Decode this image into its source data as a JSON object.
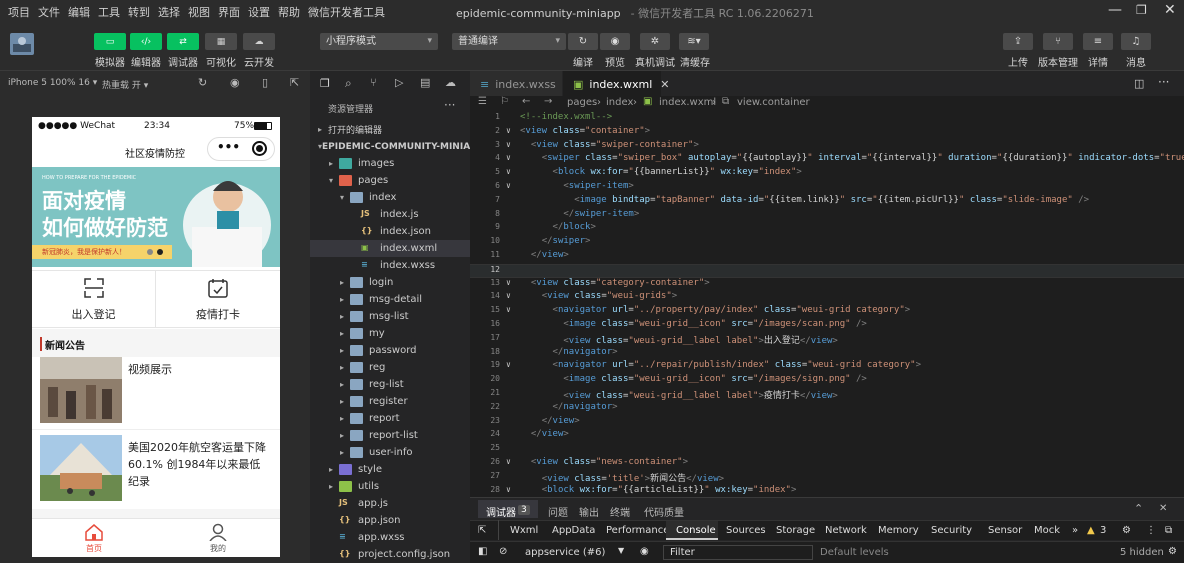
{
  "titlebar": {
    "menu": [
      "项目",
      "文件",
      "编辑",
      "工具",
      "转到",
      "选择",
      "视图",
      "界面",
      "设置",
      "帮助",
      "微信开发者工具"
    ],
    "title": "epidemic-community-miniapp",
    "subtitle": "- 微信开发者工具 RC 1.06.2206271"
  },
  "toolbar": {
    "left_buttons": [
      "模拟器",
      "编辑器",
      "调试器",
      "可视化",
      "云开发"
    ],
    "mode_select": "小程序模式",
    "compile_select": "普通编译",
    "mid_labels": [
      "编译",
      "预览",
      "真机调试",
      "清缓存"
    ],
    "right_labels": [
      "上传",
      "版本管理",
      "详情",
      "消息"
    ]
  },
  "simulator": {
    "device": "iPhone 5 100% 16 ▾",
    "hot_reload": "热重载 开 ▾",
    "status": {
      "carrier": "●●●●● WeChat",
      "time": "23:34",
      "battery": "75%"
    },
    "nav_title": "社区疫情防控",
    "banner": {
      "top": "HOW TO PREPARE FOR THE EPIDEMIC",
      "line1": "面对疫情",
      "line2": "如何做好防范",
      "foot": "新冠肺炎，我是保护新人！"
    },
    "categories": [
      "出入登记",
      "疫情打卡"
    ],
    "news_title": "新闻公告",
    "news": [
      {
        "title": "视频展示"
      },
      {
        "title": "美国2020年航空客运量下降60.1% 创1984年以来最低纪录"
      }
    ],
    "tabs": [
      "首页",
      "我的"
    ]
  },
  "explorer": {
    "header": "资源管理器",
    "open_editors": "打开的编辑器",
    "project": "EPIDEMIC-COMMUNITY-MINIAPP",
    "items": [
      {
        "name": "images",
        "depth": 1,
        "type": "folder-img",
        "arrow": "▸"
      },
      {
        "name": "pages",
        "depth": 1,
        "type": "folder-red",
        "arrow": "▾"
      },
      {
        "name": "index",
        "depth": 2,
        "type": "folder",
        "arrow": "▾"
      },
      {
        "name": "index.js",
        "depth": 3,
        "type": "js",
        "arrow": ""
      },
      {
        "name": "index.json",
        "depth": 3,
        "type": "json",
        "arrow": ""
      },
      {
        "name": "index.wxml",
        "depth": 3,
        "type": "wxml",
        "arrow": "",
        "selected": true
      },
      {
        "name": "index.wxss",
        "depth": 3,
        "type": "wxss",
        "arrow": ""
      },
      {
        "name": "login",
        "depth": 2,
        "type": "folder",
        "arrow": "▸"
      },
      {
        "name": "msg-detail",
        "depth": 2,
        "type": "folder",
        "arrow": "▸"
      },
      {
        "name": "msg-list",
        "depth": 2,
        "type": "folder",
        "arrow": "▸"
      },
      {
        "name": "my",
        "depth": 2,
        "type": "folder",
        "arrow": "▸"
      },
      {
        "name": "password",
        "depth": 2,
        "type": "folder",
        "arrow": "▸"
      },
      {
        "name": "reg",
        "depth": 2,
        "type": "folder",
        "arrow": "▸"
      },
      {
        "name": "reg-list",
        "depth": 2,
        "type": "folder",
        "arrow": "▸"
      },
      {
        "name": "register",
        "depth": 2,
        "type": "folder",
        "arrow": "▸"
      },
      {
        "name": "report",
        "depth": 2,
        "type": "folder",
        "arrow": "▸"
      },
      {
        "name": "report-list",
        "depth": 2,
        "type": "folder",
        "arrow": "▸"
      },
      {
        "name": "user-info",
        "depth": 2,
        "type": "folder",
        "arrow": "▸"
      },
      {
        "name": "style",
        "depth": 1,
        "type": "folder-purple",
        "arrow": "▸"
      },
      {
        "name": "utils",
        "depth": 1,
        "type": "folder-green",
        "arrow": "▸"
      },
      {
        "name": "app.js",
        "depth": 1,
        "type": "js",
        "arrow": ""
      },
      {
        "name": "app.json",
        "depth": 1,
        "type": "json",
        "arrow": ""
      },
      {
        "name": "app.wxss",
        "depth": 1,
        "type": "wxss",
        "arrow": ""
      },
      {
        "name": "project.config.json",
        "depth": 1,
        "type": "json",
        "arrow": ""
      }
    ]
  },
  "editor": {
    "tabs": [
      "index.wxss",
      "index.wxml"
    ],
    "active_tab": "index.wxml",
    "breadcrumb": [
      "pages",
      "index",
      "index.wxml",
      "view.container"
    ],
    "lines": [
      {
        "n": "1",
        "f": "",
        "h": "<span class='c'>&lt;!--index.wxml--&gt;</span>"
      },
      {
        "n": "2",
        "f": "∨",
        "h": "<span class='p'>&lt;</span><span class='t'>view</span> <span class='a'>class</span><span class='d'>=</span><span class='s'>\"container\"</span><span class='p'>&gt;</span>"
      },
      {
        "n": "3",
        "f": "∨",
        "h": "  <span class='p'>&lt;</span><span class='t'>view</span> <span class='a'>class</span><span class='d'>=</span><span class='s'>\"swiper-container\"</span><span class='p'>&gt;</span>"
      },
      {
        "n": "4",
        "f": "∨",
        "h": "    <span class='p'>&lt;</span><span class='t'>swiper</span> <span class='a'>class</span><span class='d'>=</span><span class='s'>\"swiper_box\"</span> <span class='a'>autoplay</span><span class='d'>=</span><span class='s'>\"</span><span class='d'>{{autoplay}}</span><span class='s'>\"</span> <span class='a'>interval</span><span class='d'>=</span><span class='s'>\"</span><span class='d'>{{interval}}</span><span class='s'>\"</span> <span class='a'>duration</span><span class='d'>=</span><span class='s'>\"</span><span class='d'>{{duration}}</span><span class='s'>\"</span> <span class='a'>indicator-dots</span><span class='d'>=</span><span class='s'>\"true\"</span><span class='p'>&gt;</span>"
      },
      {
        "n": "5",
        "f": "∨",
        "h": "      <span class='p'>&lt;</span><span class='t'>block</span> <span class='a'>wx:for</span><span class='d'>=</span><span class='s'>\"</span><span class='d'>{{bannerList}}</span><span class='s'>\"</span> <span class='a'>wx:key</span><span class='d'>=</span><span class='s'>\"index\"</span><span class='p'>&gt;</span>"
      },
      {
        "n": "6",
        "f": "∨",
        "h": "        <span class='p'>&lt;</span><span class='t'>swiper-item</span><span class='p'>&gt;</span>"
      },
      {
        "n": "7",
        "f": "",
        "h": "          <span class='p'>&lt;</span><span class='t'>image</span> <span class='a'>bindtap</span><span class='d'>=</span><span class='s'>\"tapBanner\"</span> <span class='a'>data-id</span><span class='d'>=</span><span class='s'>\"</span><span class='d'>{{item.link}}</span><span class='s'>\"</span> <span class='a'>src</span><span class='d'>=</span><span class='s'>\"</span><span class='d'>{{item.picUrl}}</span><span class='s'>\"</span> <span class='a'>class</span><span class='d'>=</span><span class='s'>\"slide-image\"</span> <span class='p'>/&gt;</span>"
      },
      {
        "n": "8",
        "f": "",
        "h": "        <span class='p'>&lt;/</span><span class='t'>swiper-item</span><span class='p'>&gt;</span>"
      },
      {
        "n": "9",
        "f": "",
        "h": "      <span class='p'>&lt;/</span><span class='t'>block</span><span class='p'>&gt;</span>"
      },
      {
        "n": "10",
        "f": "",
        "h": "    <span class='p'>&lt;/</span><span class='t'>swiper</span><span class='p'>&gt;</span>"
      },
      {
        "n": "11",
        "f": "",
        "h": "  <span class='p'>&lt;/</span><span class='t'>view</span><span class='p'>&gt;</span>"
      },
      {
        "n": "12",
        "f": "",
        "h": "",
        "hl": true
      },
      {
        "n": "13",
        "f": "∨",
        "h": "  <span class='p'>&lt;</span><span class='t'>view</span> <span class='a'>class</span><span class='d'>=</span><span class='s'>\"category-container\"</span><span class='p'>&gt;</span>"
      },
      {
        "n": "14",
        "f": "∨",
        "h": "    <span class='p'>&lt;</span><span class='t'>view</span> <span class='a'>class</span><span class='d'>=</span><span class='s'>\"weui-grids\"</span><span class='p'>&gt;</span>"
      },
      {
        "n": "15",
        "f": "∨",
        "h": "      <span class='p'>&lt;</span><span class='t'>navigator</span> <span class='a'>url</span><span class='d'>=</span><span class='s'>\"../property/pay/index\"</span> <span class='a'>class</span><span class='d'>=</span><span class='s'>\"weui-grid category\"</span><span class='p'>&gt;</span>"
      },
      {
        "n": "16",
        "f": "",
        "h": "        <span class='p'>&lt;</span><span class='t'>image</span> <span class='a'>class</span><span class='d'>=</span><span class='s'>\"weui-grid__icon\"</span> <span class='a'>src</span><span class='d'>=</span><span class='s'>\"/images/scan.png\"</span> <span class='p'>/&gt;</span>"
      },
      {
        "n": "17",
        "f": "",
        "h": "        <span class='p'>&lt;</span><span class='t'>view</span> <span class='a'>class</span><span class='d'>=</span><span class='s'>\"weui-grid__label label\"</span><span class='p'>&gt;</span><span class='d'>出入登记</span><span class='p'>&lt;/</span><span class='t'>view</span><span class='p'>&gt;</span>"
      },
      {
        "n": "18",
        "f": "",
        "h": "      <span class='p'>&lt;/</span><span class='t'>navigator</span><span class='p'>&gt;</span>"
      },
      {
        "n": "19",
        "f": "∨",
        "h": "      <span class='p'>&lt;</span><span class='t'>navigator</span> <span class='a'>url</span><span class='d'>=</span><span class='s'>\"../repair/publish/index\"</span> <span class='a'>class</span><span class='d'>=</span><span class='s'>\"weui-grid category\"</span><span class='p'>&gt;</span>"
      },
      {
        "n": "20",
        "f": "",
        "h": "        <span class='p'>&lt;</span><span class='t'>image</span> <span class='a'>class</span><span class='d'>=</span><span class='s'>\"weui-grid__icon\"</span> <span class='a'>src</span><span class='d'>=</span><span class='s'>\"/images/sign.png\"</span> <span class='p'>/&gt;</span>"
      },
      {
        "n": "21",
        "f": "",
        "h": "        <span class='p'>&lt;</span><span class='t'>view</span> <span class='a'>class</span><span class='d'>=</span><span class='s'>\"weui-grid__label label\"</span><span class='p'>&gt;</span><span class='d'>疫情打卡</span><span class='p'>&lt;/</span><span class='t'>view</span><span class='p'>&gt;</span>"
      },
      {
        "n": "22",
        "f": "",
        "h": "      <span class='p'>&lt;/</span><span class='t'>navigator</span><span class='p'>&gt;</span>"
      },
      {
        "n": "23",
        "f": "",
        "h": "    <span class='p'>&lt;/</span><span class='t'>view</span><span class='p'>&gt;</span>"
      },
      {
        "n": "24",
        "f": "",
        "h": "  <span class='p'>&lt;/</span><span class='t'>view</span><span class='p'>&gt;</span>"
      },
      {
        "n": "25",
        "f": "",
        "h": ""
      },
      {
        "n": "26",
        "f": "∨",
        "h": "  <span class='p'>&lt;</span><span class='t'>view</span> <span class='a'>class</span><span class='d'>=</span><span class='s'>\"news-container\"</span><span class='p'>&gt;</span>"
      },
      {
        "n": "27",
        "f": "",
        "h": "    <span class='p'>&lt;</span><span class='t'>view</span> <span class='a'>class</span><span class='d'>=</span><span class='s'>'title'</span><span class='p'>&gt;</span><span class='d'>新闻公告</span><span class='p'>&lt;/</span><span class='t'>view</span><span class='p'>&gt;</span>"
      },
      {
        "n": "28",
        "f": "∨",
        "h": "    <span class='p'>&lt;</span><span class='t'>block</span> <span class='a'>wx:for</span><span class='d'>=</span><span class='s'>\"</span><span class='d'>{{articleList}}</span><span class='s'>\"</span> <span class='a'>wx:key</span><span class='d'>=</span><span class='s'>\"index\"</span><span class='p'>&gt;</span>"
      }
    ]
  },
  "devtools": {
    "panel_tabs": [
      "调试器",
      "问题",
      "输出",
      "终端",
      "代码质量"
    ],
    "badge": "3",
    "tabs": [
      "Wxml",
      "AppData",
      "Performance",
      "Console",
      "Sources",
      "Storage",
      "Network",
      "Memory",
      "Security",
      "Sensor",
      "Mock"
    ],
    "active": "Console",
    "more": "»",
    "warn_count": "3",
    "context": "appservice (#6)",
    "filter_placeholder": "Filter",
    "levels": "Default levels",
    "hidden": "5 hidden"
  }
}
